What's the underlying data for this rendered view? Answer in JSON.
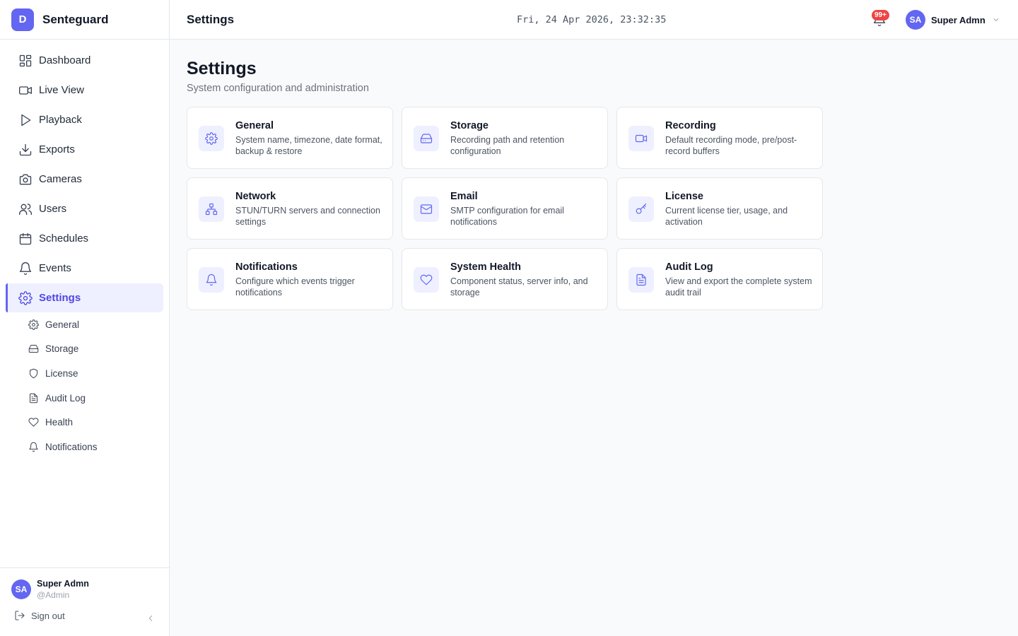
{
  "brand": {
    "logo_letter": "D",
    "name": "Senteguard",
    "accent_color": "#6366f1"
  },
  "sidebar": {
    "items": [
      {
        "label": "Dashboard",
        "icon": "layout-grid-icon"
      },
      {
        "label": "Live View",
        "icon": "video-icon"
      },
      {
        "label": "Playback",
        "icon": "play-icon"
      },
      {
        "label": "Exports",
        "icon": "download-icon"
      },
      {
        "label": "Cameras",
        "icon": "camera-icon"
      },
      {
        "label": "Users",
        "icon": "users-icon"
      },
      {
        "label": "Schedules",
        "icon": "calendar-icon"
      },
      {
        "label": "Events",
        "icon": "bell-icon"
      },
      {
        "label": "Settings",
        "icon": "gear-icon",
        "active": true
      }
    ],
    "sub_items": [
      {
        "label": "General",
        "icon": "gear-icon"
      },
      {
        "label": "Storage",
        "icon": "hard-drive-icon"
      },
      {
        "label": "License",
        "icon": "shield-icon"
      },
      {
        "label": "Audit Log",
        "icon": "file-text-icon"
      },
      {
        "label": "Health",
        "icon": "heart-icon"
      },
      {
        "label": "Notifications",
        "icon": "bell-icon"
      }
    ],
    "footer": {
      "avatar_initials": "SA",
      "user_name": "Super Admn",
      "user_handle": "@Admin",
      "sign_out_label": "Sign out"
    }
  },
  "header": {
    "title": "Settings",
    "datetime": "Fri, 24 Apr 2026, 23:32:35",
    "notification_badge": "99+",
    "user": {
      "initials": "SA",
      "name": "Super Admn"
    }
  },
  "main": {
    "title": "Settings",
    "subtitle": "System configuration and administration",
    "cards": [
      {
        "title": "General",
        "description": "System name, timezone, date format, backup & restore",
        "icon": "gear-icon"
      },
      {
        "title": "Storage",
        "description": "Recording path and retention configuration",
        "icon": "hard-drive-icon"
      },
      {
        "title": "Recording",
        "description": "Default recording mode, pre/post-record buffers",
        "icon": "video-icon"
      },
      {
        "title": "Network",
        "description": "STUN/TURN servers and connection settings",
        "icon": "network-icon"
      },
      {
        "title": "Email",
        "description": "SMTP configuration for email notifications",
        "icon": "mail-icon"
      },
      {
        "title": "License",
        "description": "Current license tier, usage, and activation",
        "icon": "key-icon"
      },
      {
        "title": "Notifications",
        "description": "Configure which events trigger notifications",
        "icon": "bell-icon"
      },
      {
        "title": "System Health",
        "description": "Component status, server info, and storage",
        "icon": "heart-icon"
      },
      {
        "title": "Audit Log",
        "description": "View and export the complete system audit trail",
        "icon": "file-text-icon"
      }
    ]
  }
}
